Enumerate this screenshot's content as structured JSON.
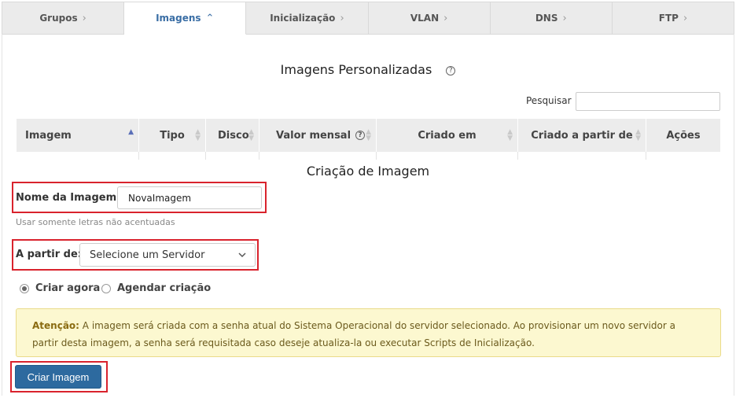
{
  "tabs": [
    {
      "label": "Grupos",
      "active": false
    },
    {
      "label": "Imagens",
      "active": true
    },
    {
      "label": "Inicialização",
      "active": false
    },
    {
      "label": "VLAN",
      "active": false
    },
    {
      "label": "DNS",
      "active": false
    },
    {
      "label": "FTP",
      "active": false
    }
  ],
  "page": {
    "title": "Imagens Personalizadas",
    "search_label": "Pesquisar",
    "search_value": ""
  },
  "table": {
    "columns": [
      {
        "label": "Imagem",
        "sort": "asc"
      },
      {
        "label": "Tipo",
        "sort": "both"
      },
      {
        "label": "Disco",
        "sort": "both"
      },
      {
        "label": "Valor mensal",
        "sort": "both",
        "help": true
      },
      {
        "label": "Criado em",
        "sort": "both"
      },
      {
        "label": "Criado a partir de",
        "sort": "both"
      },
      {
        "label": "Ações",
        "sort": "none"
      }
    ]
  },
  "form": {
    "title": "Criação de Imagem",
    "name_label": "Nome da Imagem:",
    "name_value": "NovaImagem",
    "name_hint": "Usar somente letras não acentuadas",
    "source_label": "A partir de:",
    "source_selected": "Selecione um Servidor",
    "radio_now": "Criar agora",
    "radio_schedule": "Agendar criação",
    "radio_selected": "now",
    "alert_strong": "Atenção:",
    "alert_line1": "A imagem será criada com a senha atual do Sistema Operacional do servidor selecionado. Ao provisionar um novo servidor a",
    "alert_line2": "partir desta imagem, a senha será requisitada caso deseje atualiza-la ou executar Scripts de Inicialização.",
    "submit_label": "Criar Imagem"
  },
  "colors": {
    "accent": "#2d6a9f",
    "highlight": "#d9232d",
    "alert_bg": "#fcf8d0"
  }
}
